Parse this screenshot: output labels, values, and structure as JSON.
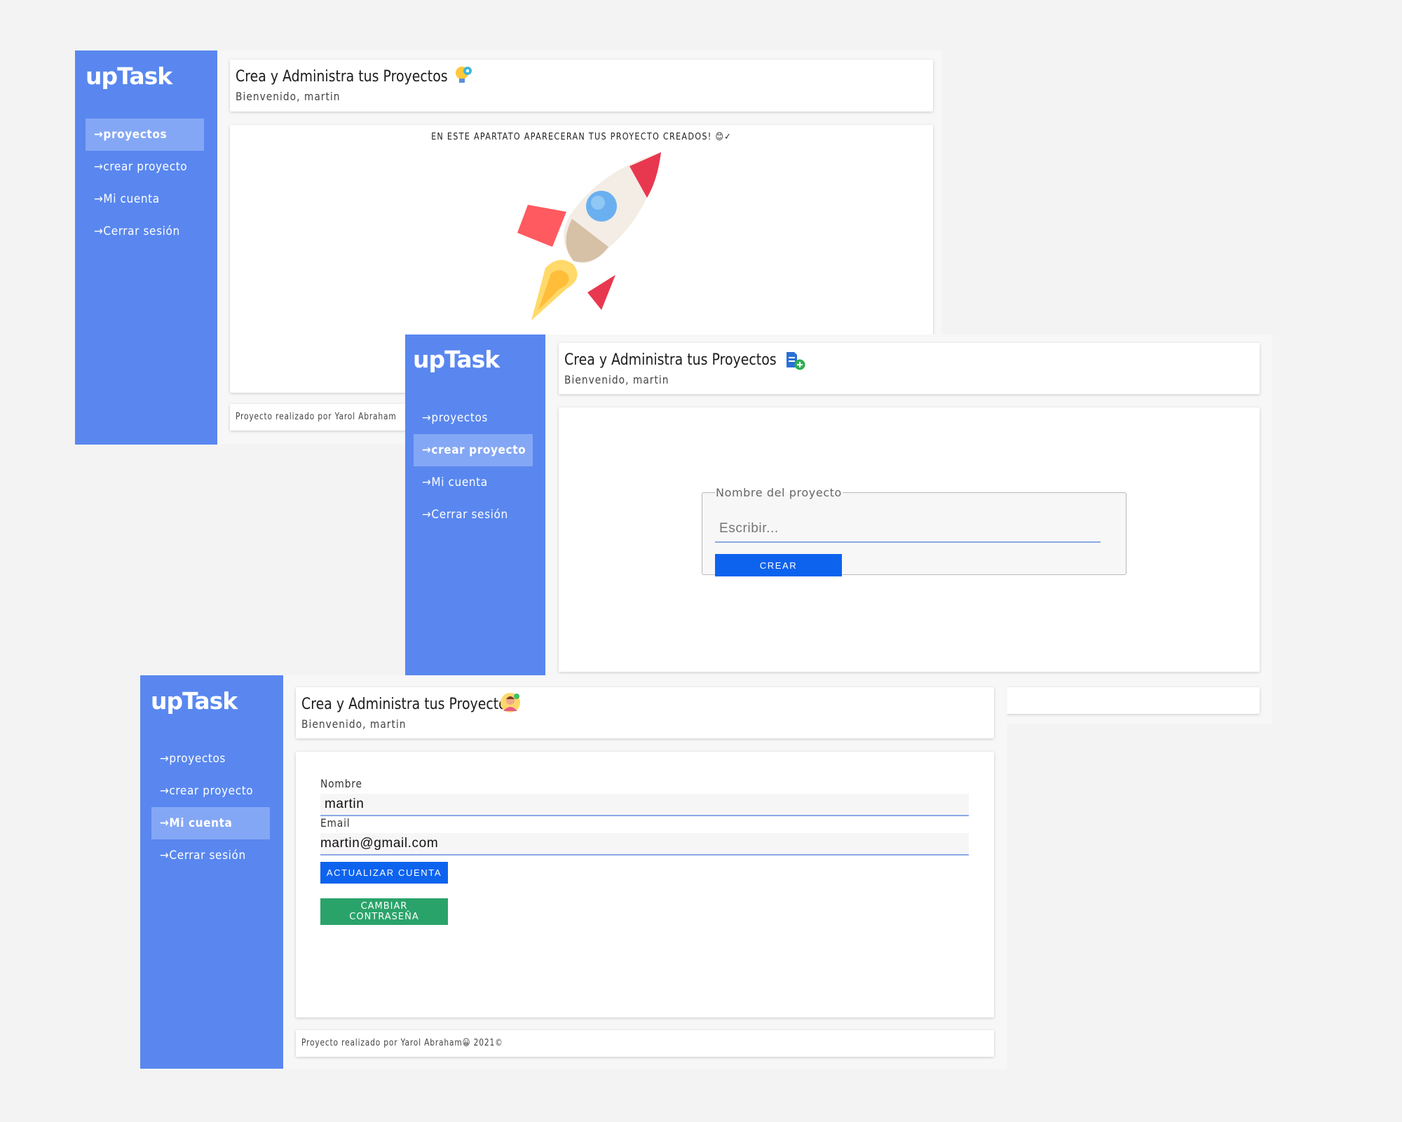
{
  "brand": "upTask",
  "nav": [
    "→proyectos",
    "→crear proyecto",
    "→Mi cuenta",
    "→Cerrar sesión"
  ],
  "header": {
    "title": "Crea y Administra tus Proyectos",
    "subtitle": "Bienvenido, martin"
  },
  "projects_screen": {
    "empty_message": "EN ESTE APARTATO APARECERAN TUS PROYECTO CREADOS! 😊✓",
    "footer": "Proyecto realizado por Yarol Abraham",
    "header_icon": "lightbulb-gear-icon",
    "illustration": "rocket-illustration"
  },
  "create_screen": {
    "legend": "Nombre del proyecto",
    "input_placeholder": "Escribir...",
    "button": "CREAR",
    "header_icon": "add-document-icon"
  },
  "account_screen": {
    "name_label": "Nombre",
    "name_value": "martin",
    "email_label": "Email",
    "email_value": "martin@gmail.com",
    "update_button": "ACTUALIZAR CUENTA",
    "password_button": "CAMBIAR CONTRASEÑA",
    "footer": "Proyecto realizado por Yarol Abraham😀 2021©",
    "header_icon": "user-avatar-icon"
  },
  "colors": {
    "sidebar": "#5987ef",
    "sidebar_active": "#84a7f5",
    "primary_button": "#0d63ee",
    "success_button": "#2aa36a"
  }
}
